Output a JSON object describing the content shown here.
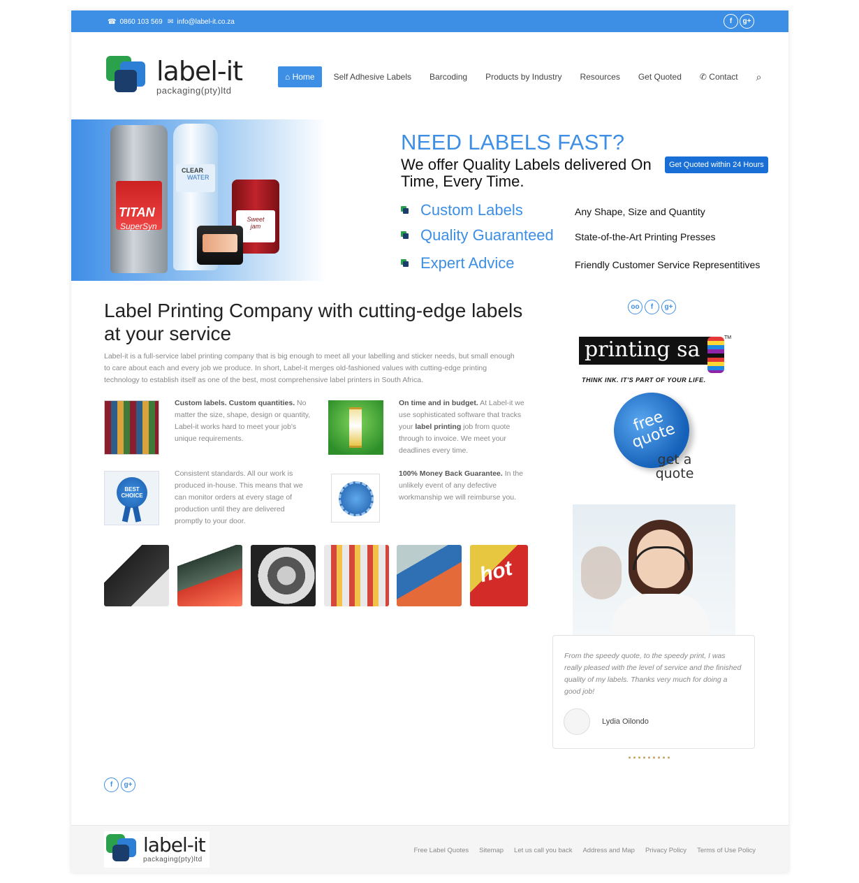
{
  "colors": {
    "brand_blue": "#3d8ee5",
    "dark_blue": "#1a6fd6"
  },
  "topbar": {
    "phone": "0860 103 569",
    "email": "info@label-it.co.za",
    "social": [
      "f",
      "g+"
    ]
  },
  "logo": {
    "name": "label-it",
    "sub": "packaging(pty)ltd"
  },
  "nav": {
    "items": [
      "Home",
      "Self Adhesive Labels",
      "Barcoding",
      "Products by Industry",
      "Resources",
      "Get Quoted",
      "Contact"
    ],
    "active": "Home"
  },
  "hero": {
    "title": "NEED LABELS FAST?",
    "subtitle": "We offer Quality Labels delivered On Time, Every Time.",
    "button": "Get Quoted within 24 Hours",
    "features": [
      {
        "label": "Custom Labels",
        "desc": "Any Shape, Size and Quantity"
      },
      {
        "label": "Quality Guaranteed",
        "desc": "State-of-the-Art Printing Presses"
      },
      {
        "label": "Expert Advice",
        "desc": "Friendly Customer Service Representitives"
      }
    ],
    "product_texts": {
      "titan": "TITAN",
      "supersyn": "SuperSyn",
      "clear": "CLEAR",
      "water": "WATER",
      "jam": "Sweet jam"
    }
  },
  "main": {
    "heading": "Label Printing Company with cutting-edge labels at your service",
    "intro": "Label-it is a full-service label printing company that is big enough to meet all your labelling and sticker needs, but small enough to care about each and every job we produce. In short, Label-it merges old-fashioned values with cutting-edge printing technology to establish itself as one of the best, most comprehensive label printers in South Africa.",
    "features": [
      {
        "bold": "Custom labels. Custom quantities.",
        "text": " No matter the size, shape, design or quantity, Label-it works hard to meet your job's unique requirements."
      },
      {
        "bold": "On time and in budget.",
        "text": " At Label-it we use sophisticated software that tracks your ",
        "bold2": "label printing",
        "text2": " job from quote through to invoice. We meet your deadlines every time."
      },
      {
        "text": "Consistent standards. All our work is produced in-house. This means that we can monitor orders at every stage of production until they are delivered promptly to your door."
      },
      {
        "bold": "100% Money Back Guarantee.",
        "text": " In the unlikely event of any defective workmanship we will reimburse you."
      }
    ],
    "badge_text": "BEST CHOICE",
    "thumbs": [
      "printer",
      "barcode-scanner",
      "label-rolls",
      "printed-rolls",
      "shaped-labels",
      "hot-label"
    ],
    "hot_text": "hot"
  },
  "sidebar": {
    "social": [
      "oo",
      "f",
      "g+"
    ],
    "printing_sa": "printing sa",
    "printing_tagline": "THINK INK. IT'S PART OF YOUR LIFE.",
    "tm": "TM",
    "badge": "free quote",
    "get_a_quote": "get a quote",
    "testimonial": {
      "quote": "From the speedy quote, to the speedy print, I was really pleased with the level of service and the finished quality of my labels. Thanks very much for doing a good job!",
      "author": "Lydia Oilondo"
    }
  },
  "footer": {
    "social": [
      "f",
      "g+"
    ],
    "links": [
      "Free Label Quotes",
      "Sitemap",
      "Let us call you back",
      "Address and Map",
      "Privacy Policy",
      "Terms of Use Policy"
    ]
  }
}
